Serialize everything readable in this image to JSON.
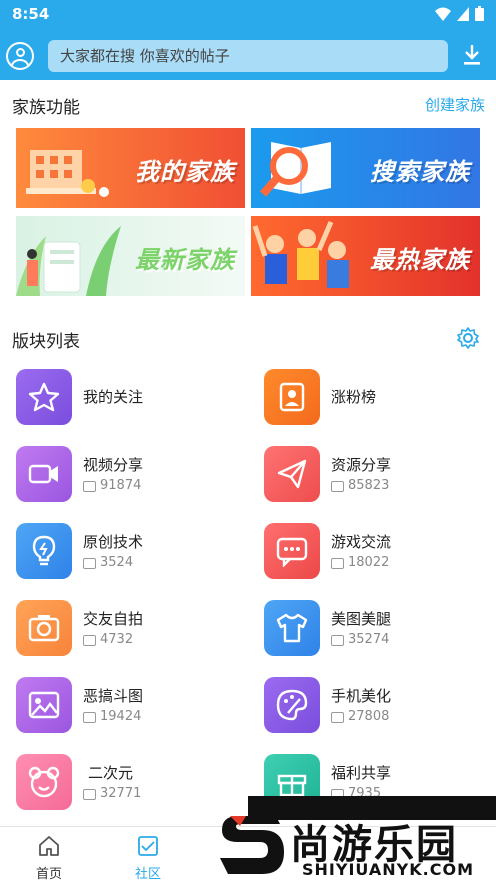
{
  "status": {
    "time": "8:54"
  },
  "search": {
    "placeholder": "大家都在搜  你喜欢的帖子"
  },
  "family": {
    "title": "家族功能",
    "create_link": "创建家族",
    "banners": [
      "我的家族",
      "搜索家族",
      "最新家族",
      "最热家族"
    ]
  },
  "boards": {
    "title": "版块列表",
    "items": [
      {
        "name": "我的关注",
        "count": ""
      },
      {
        "name": "涨粉榜",
        "count": ""
      },
      {
        "name": "视频分享",
        "count": "91874"
      },
      {
        "name": "资源分享",
        "count": "85823"
      },
      {
        "name": "原创技术",
        "count": "3524"
      },
      {
        "name": "游戏交流",
        "count": "18022"
      },
      {
        "name": "交友自拍",
        "count": "4732"
      },
      {
        "name": "美图美腿",
        "count": "35274"
      },
      {
        "name": "恶搞斗图",
        "count": "19424"
      },
      {
        "name": "手机美化",
        "count": "27808"
      },
      {
        "name": "二次元",
        "count": "32771"
      },
      {
        "name": "福利共享",
        "count": "7935"
      }
    ]
  },
  "nav": {
    "home": "首页",
    "community": "社区"
  },
  "watermark": {
    "text": "尚游乐园",
    "sub": "SHIYIUANYK.COM"
  },
  "colors": {
    "primary": "#2aa9eb"
  }
}
